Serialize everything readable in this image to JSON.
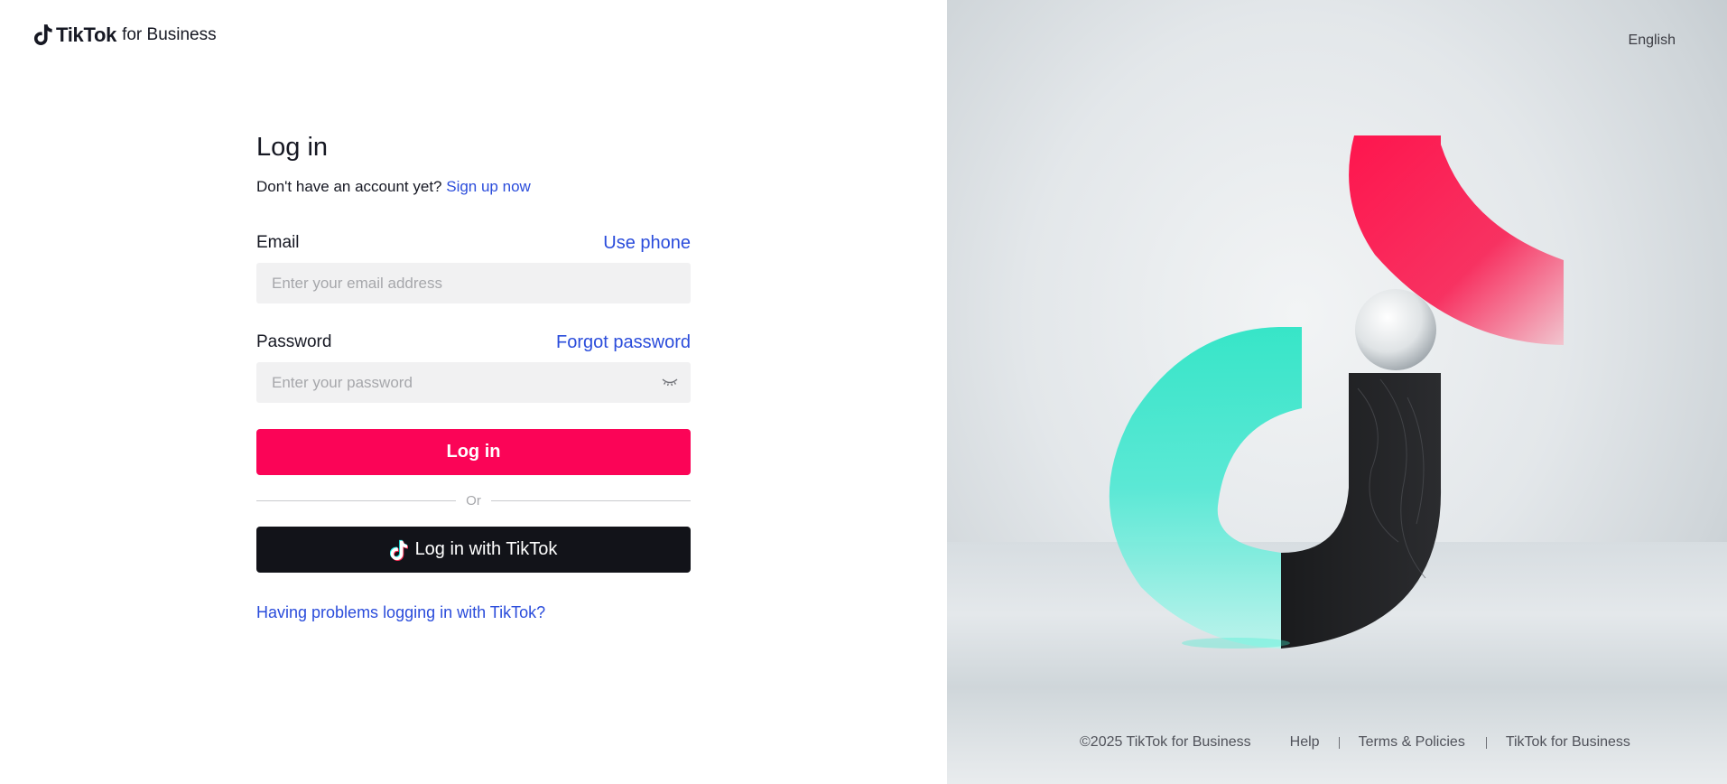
{
  "header": {
    "logo_brand": "TikTok",
    "logo_suffix": "for Business",
    "language": "English"
  },
  "form": {
    "title": "Log in",
    "no_account_text": "Don't have an account yet?",
    "signup_link": "Sign up now",
    "email_label": "Email",
    "use_phone_link": "Use phone",
    "email_placeholder": "Enter your email address",
    "password_label": "Password",
    "forgot_link": "Forgot password",
    "password_placeholder": "Enter your password",
    "login_button": "Log in",
    "or_text": "Or",
    "tiktok_button": "Log in with TikTok",
    "problem_link": "Having problems logging in with TikTok?"
  },
  "footer": {
    "copyright": "©2025 TikTok for Business",
    "links": [
      "Help",
      "Terms & Policies",
      "TikTok for Business"
    ]
  },
  "colors": {
    "primary": "#fb0457",
    "link": "#2a4cdb",
    "dark_button": "#121319"
  },
  "icons": [
    "tiktok-note-icon",
    "eye-closed-icon"
  ]
}
